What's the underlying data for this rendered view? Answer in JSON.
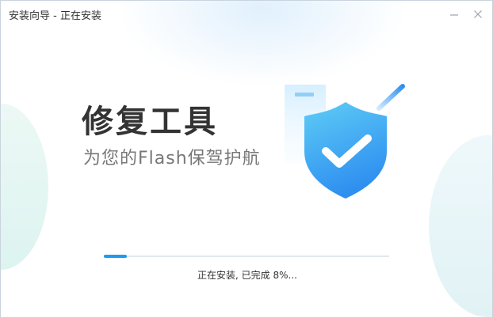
{
  "window": {
    "title": "安装向导 - 正在安装"
  },
  "hero": {
    "heading": "修复工具",
    "subheading": "为您的Flash保驾护航"
  },
  "icons": {
    "minimize": "minimize-icon",
    "close": "close-icon",
    "shield": "shield-check-icon"
  },
  "progress": {
    "percent": 8,
    "status_text": "正在安装, 已完成 8%..."
  },
  "colors": {
    "accent": "#1a9df0",
    "shield_top": "#5ecdf6",
    "shield_bottom": "#2f8ff0"
  }
}
